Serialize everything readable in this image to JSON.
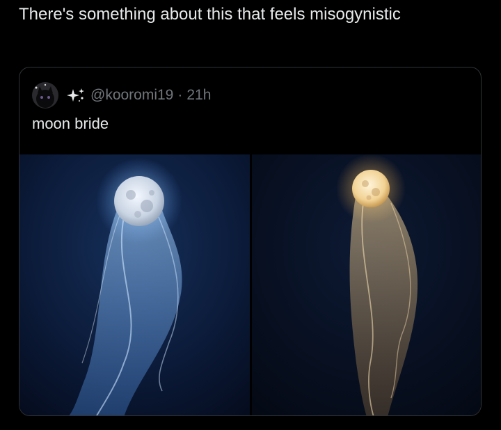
{
  "tweet": {
    "text": "There's something about this that feels misogynistic"
  },
  "quoted_tweet": {
    "avatar_icon": "dark-cat-avatar",
    "name_icon": "sparkle-star-icon",
    "handle": "@kooromi19",
    "separator": "·",
    "time": "21h",
    "text": "moon bride",
    "media": [
      {
        "description_icon": "blue-moon-veil-image",
        "accent": "#8fc4ff"
      },
      {
        "description_icon": "golden-moon-veil-image",
        "accent": "#f2c57a"
      }
    ]
  },
  "colors": {
    "background": "#000000",
    "text": "#e7e9ea",
    "muted": "#71767b",
    "border": "#2f3336"
  }
}
